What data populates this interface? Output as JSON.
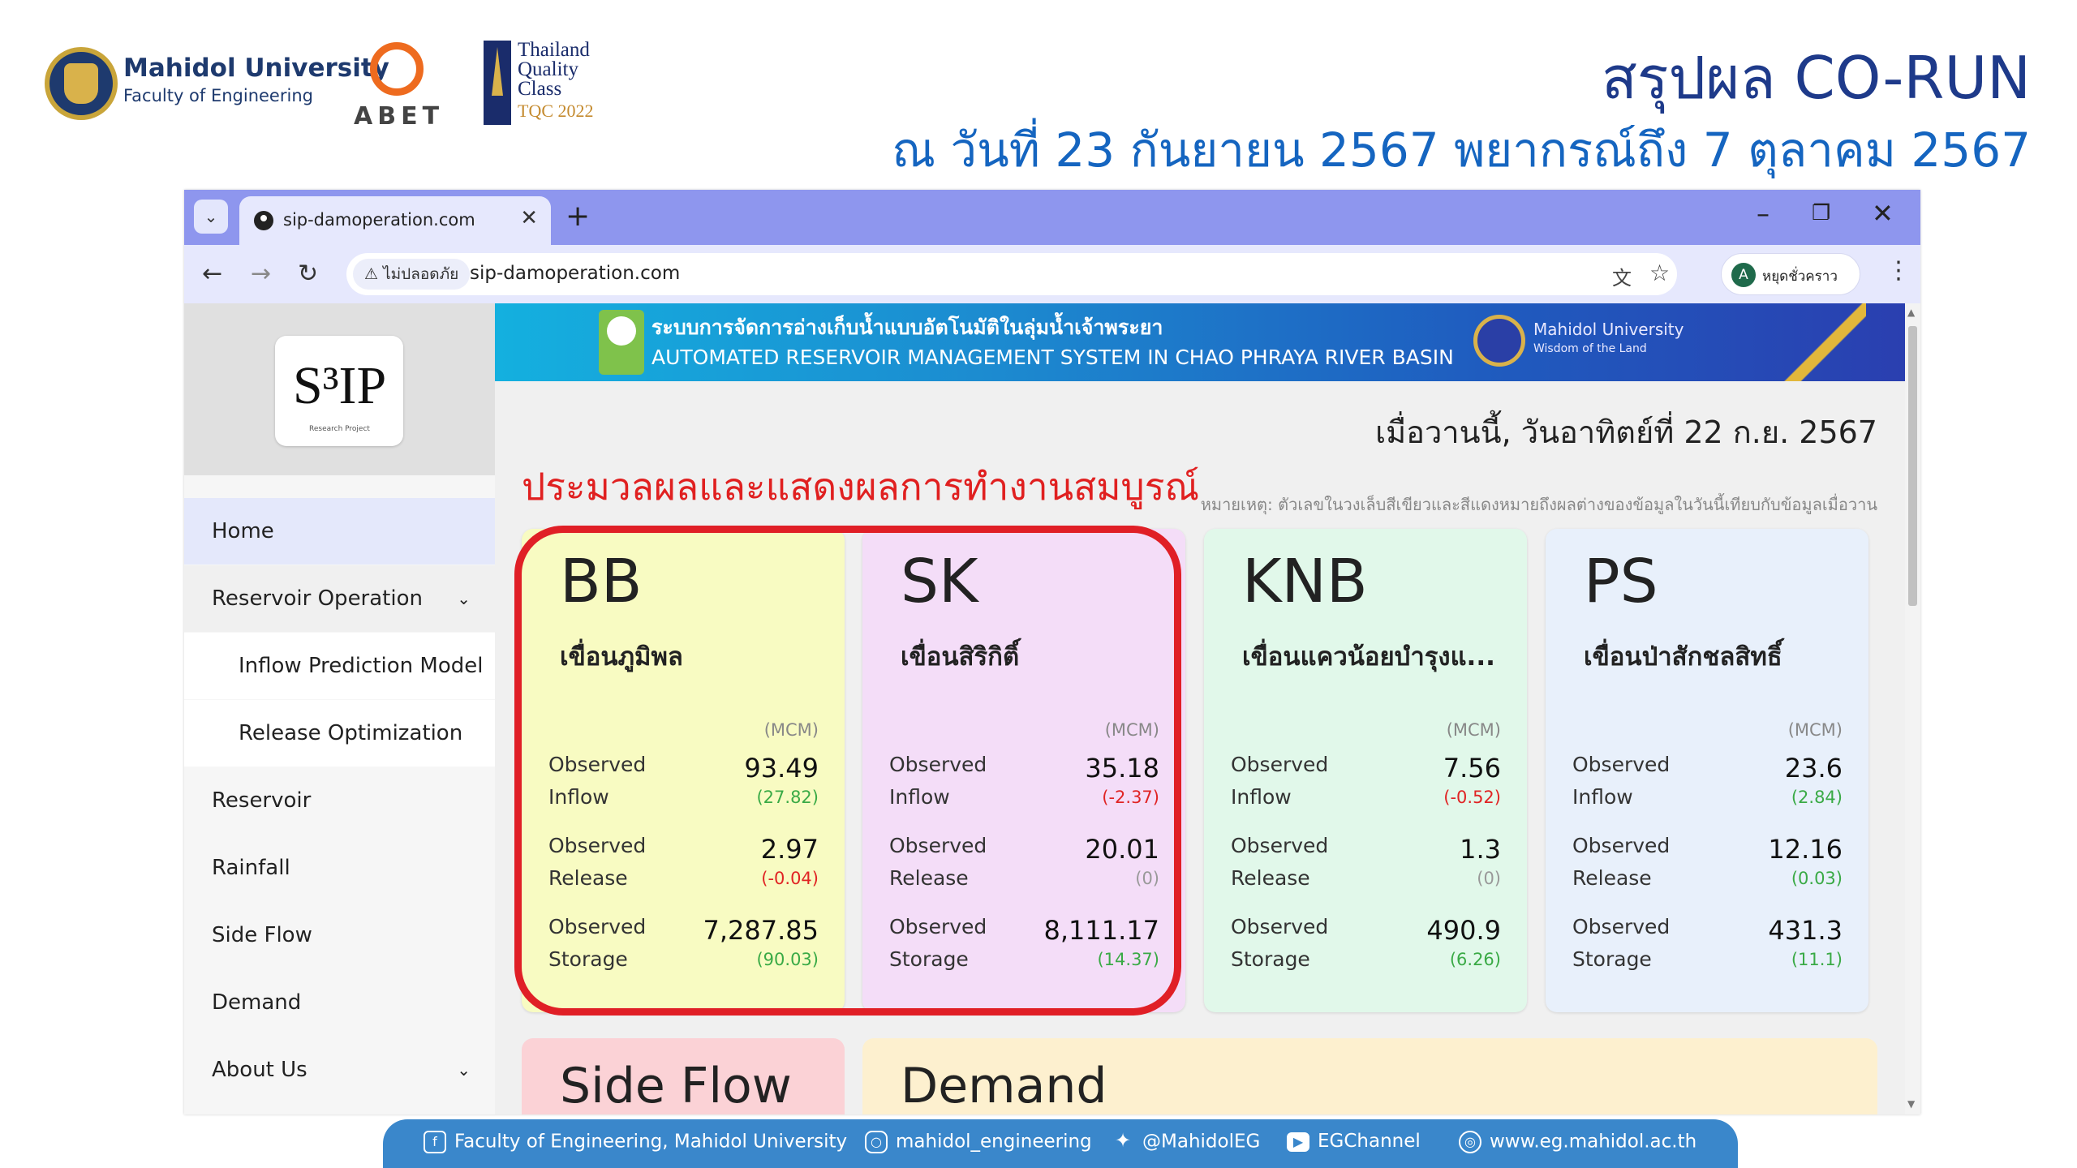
{
  "slide": {
    "title": "สรุปผล CO-RUN",
    "subtitle": "ณ วันที่ 23 กันยายน 2567 พยากรณ์ถึง 7 ตุลาคม 2567",
    "logos": {
      "mahidol_name": "Mahidol University",
      "mahidol_faculty": "Faculty of Engineering",
      "abet": "ABET",
      "tqc_line1": "Thailand",
      "tqc_line2": "Quality",
      "tqc_line3": "Class",
      "tqc_line4": "TQC 2022"
    }
  },
  "browser": {
    "tab_title": "sip-damoperation.com",
    "security_label": "ไม่ปลอดภัย",
    "url": "sip-damoperation.com",
    "profile_initial": "A",
    "profile_label": "หยุดชั่วคราว"
  },
  "site": {
    "logo_text": "S³IP",
    "logo_caption": "Research Project",
    "banner_th": "ระบบการจัดการอ่างเก็บน้ำแบบอัตโนมัติในลุ่มน้ำเจ้าพระยา",
    "banner_en": "AUTOMATED RESERVOIR MANAGEMENT SYSTEM IN CHAO PHRAYA RIVER BASIN",
    "banner_mu": "Mahidol University",
    "banner_mu_tagline": "Wisdom of the Land",
    "date_line": "เมื่อวานนี้, วันอาทิตย์ที่ 22 ก.ย. 2567",
    "heading": "ประมวลผลและแสดงผลการทำงานสมบูรณ์",
    "note": "หมายเหตุ: ตัวเลขในวงเล็บสีเขียวและสีแดงหมายถึงผลต่างของข้อมูลในวันนี้เทียบกับข้อมูลเมื่อวาน"
  },
  "nav": {
    "home": "Home",
    "reservoir_operation": "Reservoir Operation",
    "inflow_prediction": "Inflow Prediction Model",
    "release_optimization": "Release Optimization",
    "reservoir": "Reservoir",
    "rainfall": "Rainfall",
    "side_flow": "Side Flow",
    "demand": "Demand",
    "about_us": "About Us"
  },
  "labels": {
    "unit": "(MCM)",
    "observed": "Observed",
    "inflow": "Inflow",
    "release": "Release",
    "storage": "Storage"
  },
  "cards": [
    {
      "code": "BB",
      "name": "เขื่อนภูมิพล",
      "color": "#f8fbc2",
      "inflow": "93.49",
      "inflow_diff": "(27.82)",
      "inflow_diff_color": "#3aaa46",
      "release": "2.97",
      "release_diff": "(-0.04)",
      "release_diff_color": "#e02424",
      "storage": "7,287.85",
      "storage_diff": "(90.03)",
      "storage_diff_color": "#3aaa46"
    },
    {
      "code": "SK",
      "name": "เขื่อนสิริกิติ์",
      "color": "#f4ddf8",
      "inflow": "35.18",
      "inflow_diff": "(-2.37)",
      "inflow_diff_color": "#e02424",
      "release": "20.01",
      "release_diff": "(0)",
      "release_diff_color": "#999999",
      "storage": "8,111.17",
      "storage_diff": "(14.37)",
      "storage_diff_color": "#3aaa46"
    },
    {
      "code": "KNB",
      "name": "เขื่อนแควน้อยบำรุงแ...",
      "color": "#e1f8ea",
      "inflow": "7.56",
      "inflow_diff": "(-0.52)",
      "inflow_diff_color": "#e02424",
      "release": "1.3",
      "release_diff": "(0)",
      "release_diff_color": "#999999",
      "storage": "490.9",
      "storage_diff": "(6.26)",
      "storage_diff_color": "#3aaa46"
    },
    {
      "code": "PS",
      "name": "เขื่อนป่าสักชลสิทธิ์",
      "color": "#e8f0fb",
      "inflow": "23.6",
      "inflow_diff": "(2.84)",
      "inflow_diff_color": "#3aaa46",
      "release": "12.16",
      "release_diff": "(0.03)",
      "release_diff_color": "#3aaa46",
      "storage": "431.3",
      "storage_diff": "(11.1)",
      "storage_diff_color": "#3aaa46"
    }
  ],
  "bottom_cards": {
    "side_flow": "Side Flow",
    "side_flow_color": "#fbd2d6",
    "demand": "Demand",
    "demand_color": "#fdf0cf"
  },
  "footer": {
    "facebook": "Faculty of Engineering, Mahidol University",
    "instagram": "mahidol_engineering",
    "twitter": "@MahidolEG",
    "youtube": "EGChannel",
    "website": "www.eg.mahidol.ac.th"
  }
}
